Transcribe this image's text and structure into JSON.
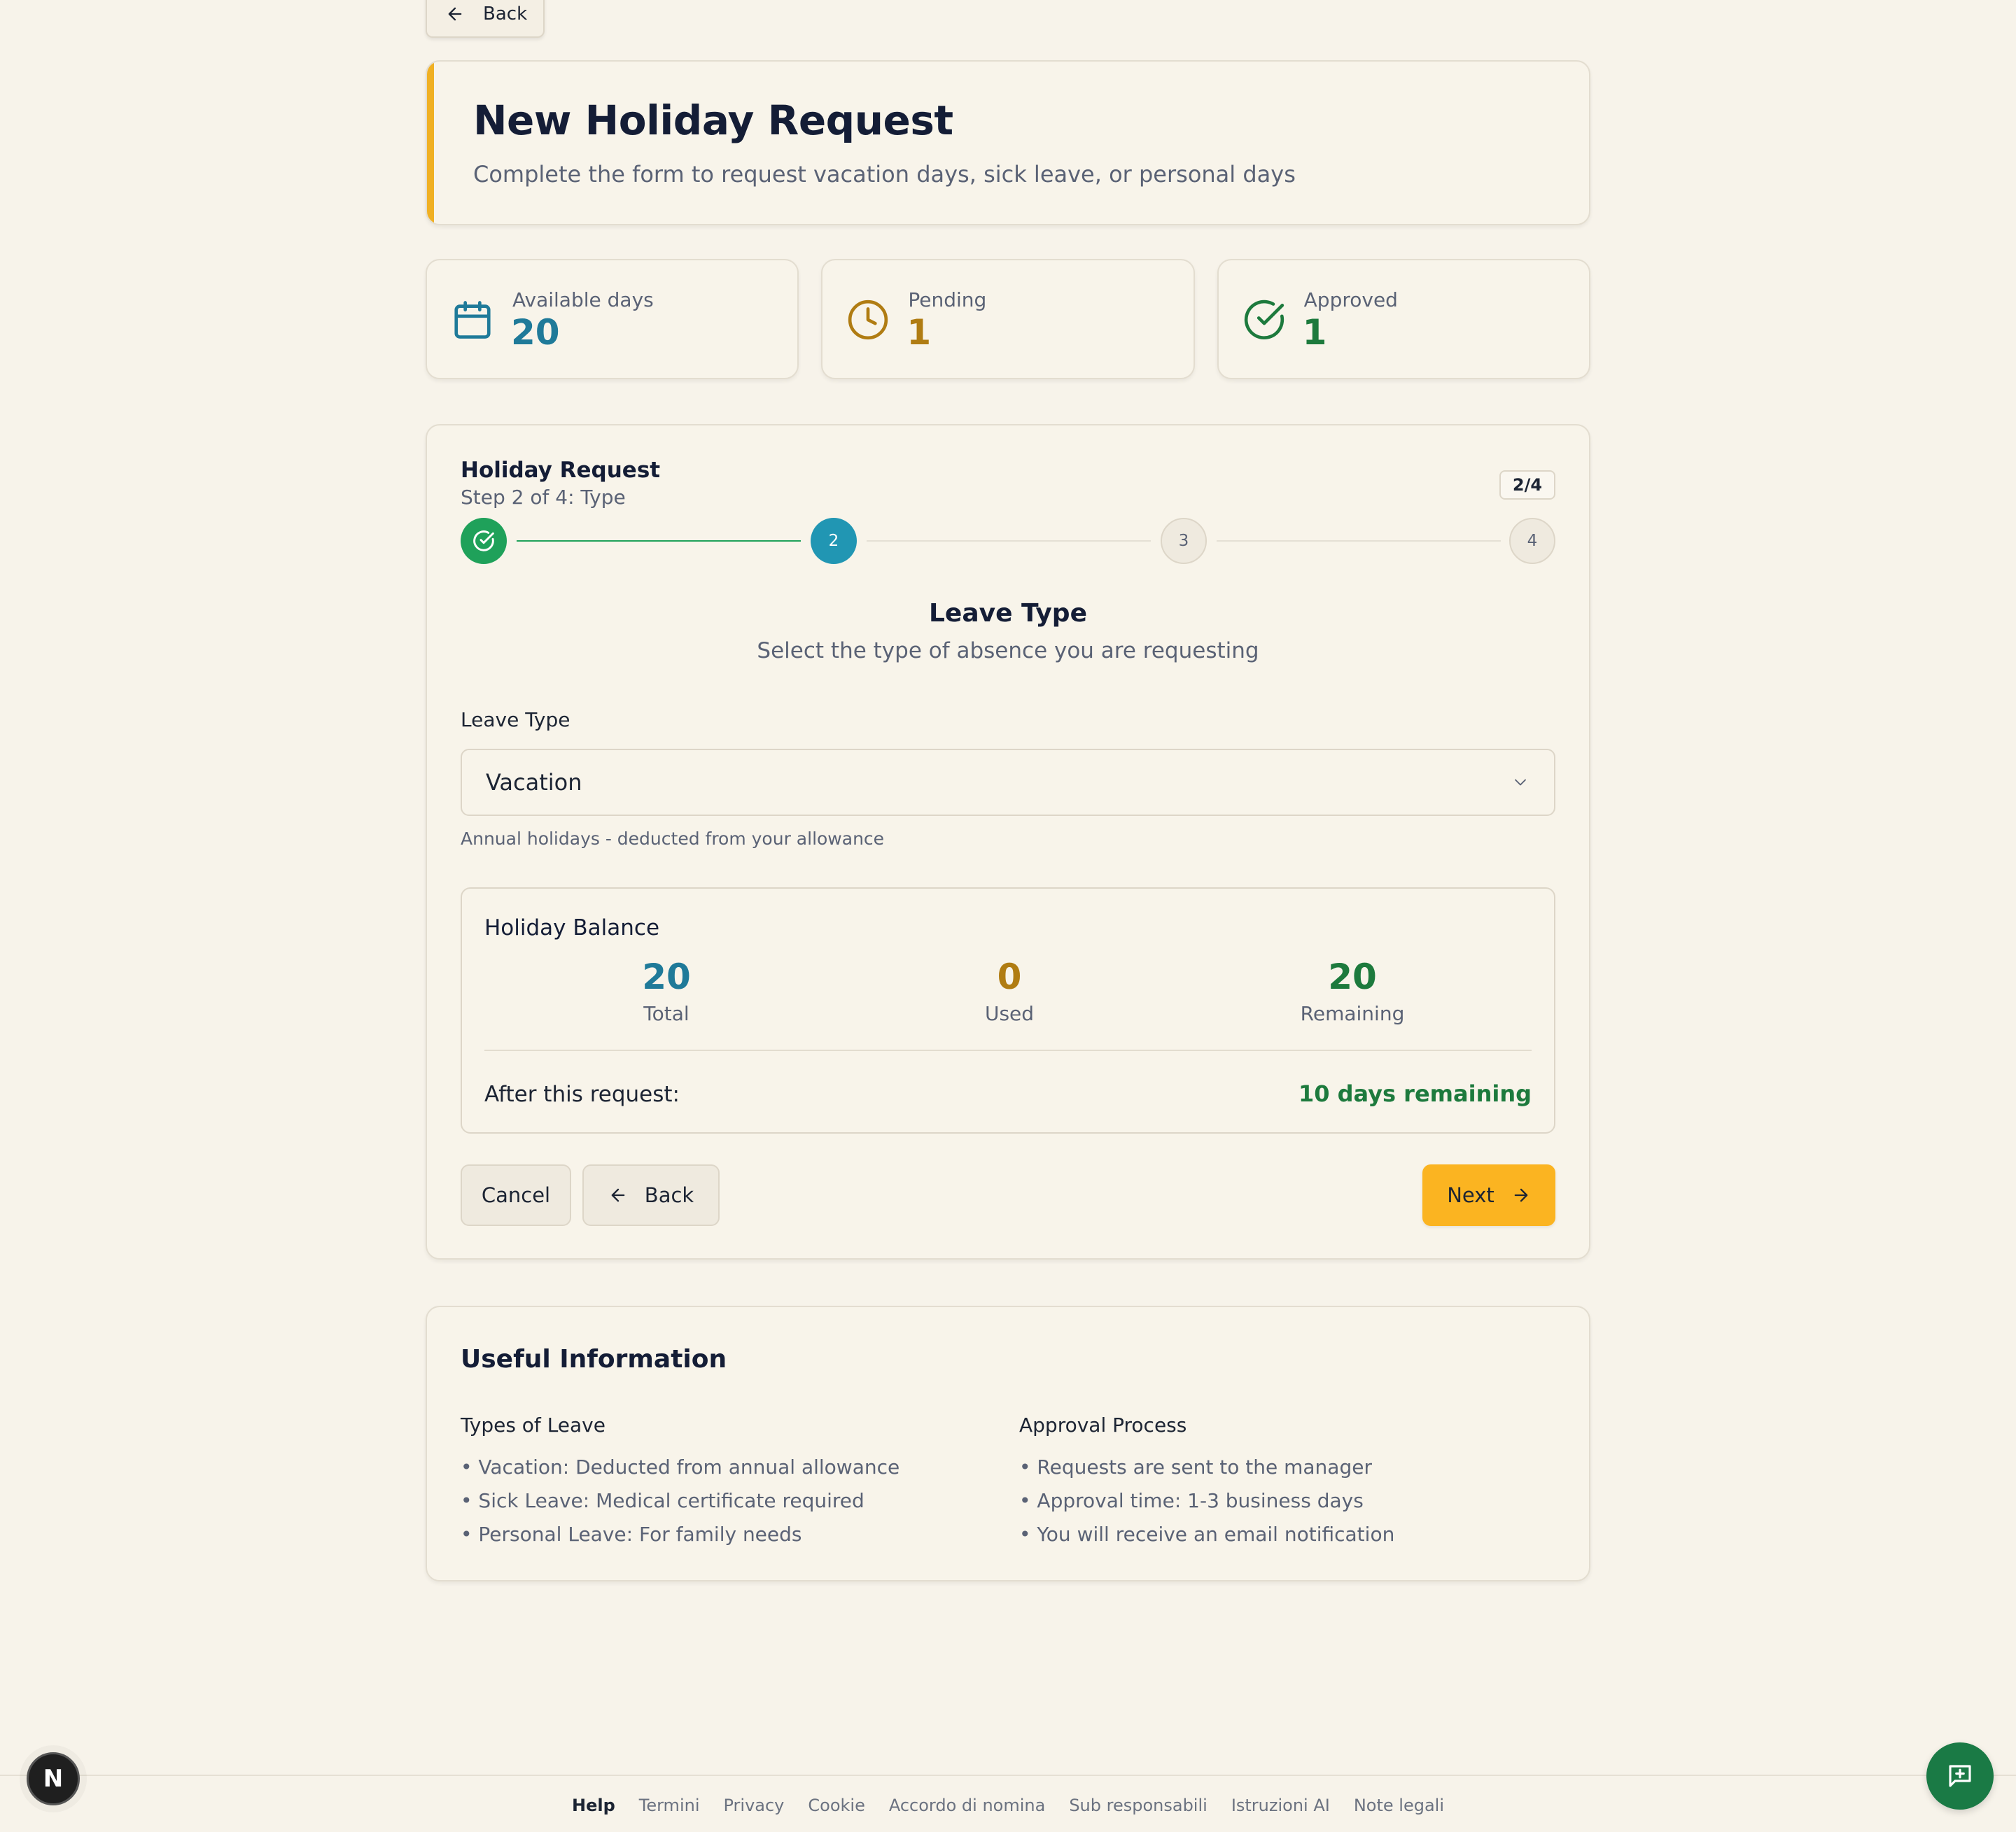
{
  "nav": {
    "back_label": "Back"
  },
  "header": {
    "title": "New Holiday Request",
    "subtitle": "Complete the form to request vacation days, sick leave, or personal days",
    "accent_color": "#f0b023"
  },
  "stats": [
    {
      "label": "Available days",
      "value": "20",
      "icon": "calendar-icon",
      "color": "#1f7a99"
    },
    {
      "label": "Pending",
      "value": "1",
      "icon": "clock-icon",
      "color": "#b07c12"
    },
    {
      "label": "Approved",
      "value": "1",
      "icon": "check-circle-icon",
      "color": "#1d7a3d"
    }
  ],
  "request": {
    "title": "Holiday Request",
    "step_text": "Step 2 of 4: Type",
    "step_badge": "2/4",
    "steps": [
      {
        "label": "",
        "state": "done"
      },
      {
        "label": "2",
        "state": "active"
      },
      {
        "label": "3",
        "state": "todo"
      },
      {
        "label": "4",
        "state": "todo"
      }
    ],
    "section_title": "Leave Type",
    "section_subtitle": "Select the type of absence you are requesting",
    "field_label": "Leave Type",
    "selected_value": "Vacation",
    "hint": "Annual holidays - deducted from your allowance",
    "balance": {
      "title": "Holiday Balance",
      "total_value": "20",
      "total_label": "Total",
      "used_value": "0",
      "used_label": "Used",
      "remaining_value": "20",
      "remaining_label": "Remaining",
      "after_label": "After this request:",
      "after_value": "10 days remaining"
    },
    "buttons": {
      "cancel": "Cancel",
      "back": "Back",
      "next": "Next"
    }
  },
  "info": {
    "title": "Useful Information",
    "types_title": "Types of Leave",
    "types": [
      "• Vacation: Deducted from annual allowance",
      "• Sick Leave: Medical certificate required",
      "• Personal Leave: For family needs"
    ],
    "approval_title": "Approval Process",
    "approval": [
      "• Requests are sent to the manager",
      "• Approval time: 1-3 business days",
      "• You will receive an email notification"
    ]
  },
  "footer": {
    "links": [
      "Help",
      "Termini",
      "Privacy",
      "Cookie",
      "Accordo di nomina",
      "Sub responsabili",
      "Istruzioni AI",
      "Note legali"
    ]
  },
  "badge": {
    "letter": "N"
  },
  "colors": {
    "primary_blue": "#1f7a99",
    "step_active": "#2196b3",
    "step_done": "#1fa15a",
    "next_button": "#fbb421",
    "chat_button": "#1a7a45"
  }
}
